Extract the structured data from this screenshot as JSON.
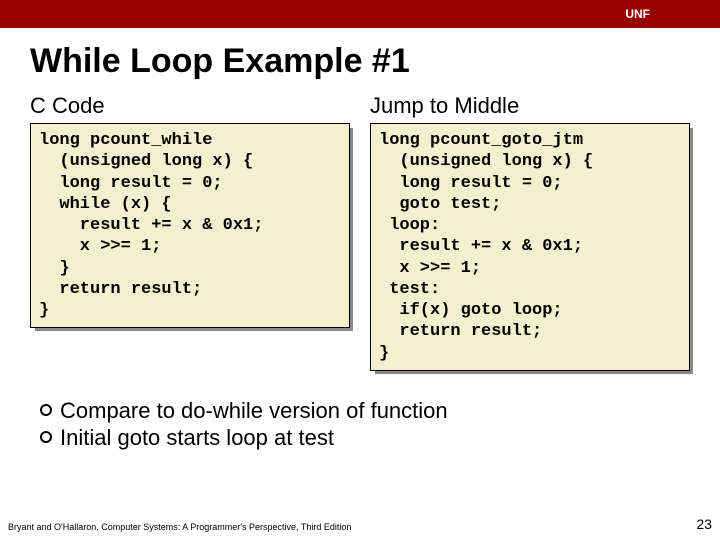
{
  "header": {
    "brand": "UNF"
  },
  "title": "While Loop Example #1",
  "left": {
    "heading": "C Code",
    "code": "long pcount_while\n  (unsigned long x) {\n  long result = 0;\n  while (x) {\n    result += x & 0x1;\n    x >>= 1;\n  }\n  return result;\n}"
  },
  "right": {
    "heading": "Jump to Middle",
    "code": "long pcount_goto_jtm\n  (unsigned long x) {\n  long result = 0;\n  goto test;\n loop:\n  result += x & 0x1;\n  x >>= 1;\n test:\n  if(x) goto loop;\n  return result;\n}"
  },
  "bullets": [
    "Compare to do-while version of function",
    "Initial goto starts loop at test"
  ],
  "footer": {
    "citation": "Bryant and O'Hallaron, Computer Systems: A Programmer's Perspective, Third Edition",
    "page": "23"
  }
}
